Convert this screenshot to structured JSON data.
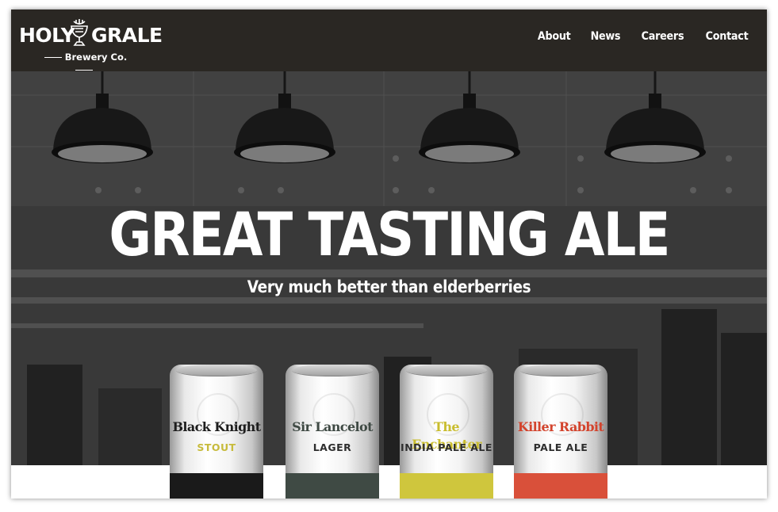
{
  "header": {
    "logo": {
      "word_left": "HOLY",
      "word_right": "GRALE",
      "subtitle": "Brewery Co."
    },
    "nav": [
      {
        "label": "About"
      },
      {
        "label": "News"
      },
      {
        "label": "Careers"
      },
      {
        "label": "Contact"
      }
    ]
  },
  "hero": {
    "title": "GREAT TASTING ALE",
    "subtitle": "Very much better than elderberries"
  },
  "cans": [
    {
      "name": "Black Knight",
      "style": "STOUT",
      "name_color": "#1d1d1d",
      "style_color": "#c7bb3c",
      "band_color": "#1a1a1a"
    },
    {
      "name": "Sir Lancelot",
      "style": "LAGER",
      "name_color": "#3f4a44",
      "style_color": "#2e2e2e",
      "band_color": "#3f4a44"
    },
    {
      "name": "The Enchanter",
      "style": "INDIA PALE ALE",
      "name_color": "#c9bd2e",
      "style_color": "#2e2e2e",
      "band_color": "#cfc63d"
    },
    {
      "name": "Killer Rabbit",
      "style": "PALE ALE",
      "name_color": "#d3442d",
      "style_color": "#2e2e2e",
      "band_color": "#d9503a"
    }
  ],
  "colors": {
    "header_bg": "#2a2723",
    "text": "#ffffff"
  }
}
